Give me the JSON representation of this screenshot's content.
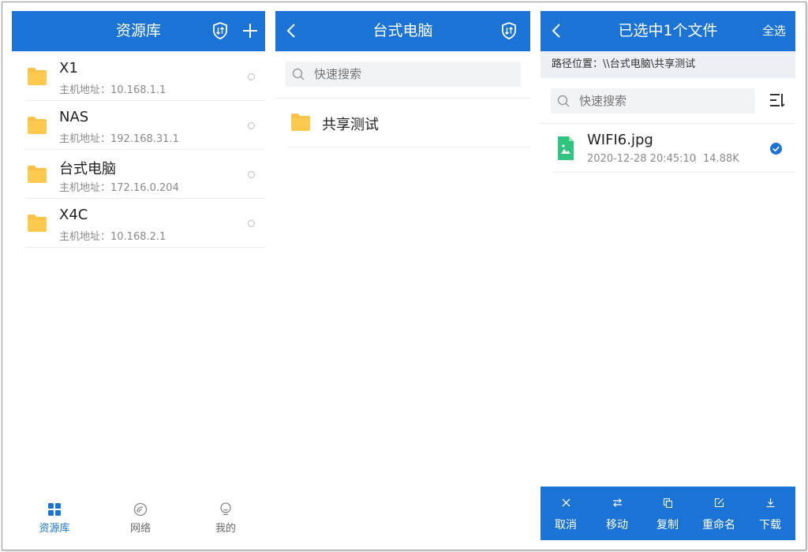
{
  "colors": {
    "primary": "#1a73d5",
    "folder": "#fbc24a",
    "image_file": "#31c47f",
    "divider": "#ececec",
    "muted": "#8a8a8a"
  },
  "panel_library": {
    "title": "资源库",
    "icons": [
      "shield-sort-icon",
      "plus-icon"
    ],
    "items": [
      {
        "name": "X1",
        "address": "主机地址：10.168.1.1"
      },
      {
        "name": "NAS",
        "address": "主机地址：192.168.31.1"
      },
      {
        "name": "台式电脑",
        "address": "主机地址：172.16.0.204"
      },
      {
        "name": "X4C",
        "address": "主机地址：10.168.2.1"
      }
    ],
    "tabs": [
      {
        "label": "资源库",
        "icon": "grid-icon",
        "active": true
      },
      {
        "label": "网络",
        "icon": "network-icon",
        "active": false
      },
      {
        "label": "我的",
        "icon": "user-icon",
        "active": false
      }
    ]
  },
  "panel_folder": {
    "title": "台式电脑",
    "search_placeholder": "快速搜索",
    "items": [
      {
        "name": "共享测试"
      }
    ]
  },
  "panel_selection": {
    "title": "已选中1个文件",
    "select_all": "全选",
    "path": "路径位置：\\\\台式电脑\\共享测试",
    "search_placeholder": "快速搜索",
    "files": [
      {
        "name": "WIFI6.jpg",
        "date": "2020-12-28 20:45:10",
        "size": "14.88K",
        "selected": true
      }
    ],
    "actions": [
      {
        "label": "取消",
        "icon": "close-icon"
      },
      {
        "label": "移动",
        "icon": "move-icon"
      },
      {
        "label": "复制",
        "icon": "copy-icon"
      },
      {
        "label": "重命名",
        "icon": "rename-icon"
      },
      {
        "label": "下载",
        "icon": "download-icon"
      }
    ]
  }
}
